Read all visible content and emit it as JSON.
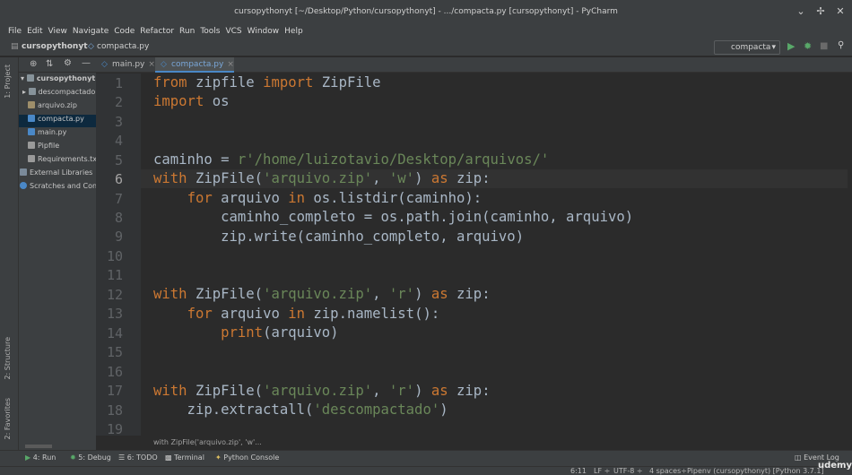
{
  "window": {
    "title": "cursopythonyt [~/Desktop/Python/cursopythonyt] - .../compacta.py [cursopythonyt] - PyCharm"
  },
  "menu": [
    "File",
    "Edit",
    "View",
    "Navigate",
    "Code",
    "Refactor",
    "Run",
    "Tools",
    "VCS",
    "Window",
    "Help"
  ],
  "nav": {
    "project": "cursopythonyt",
    "file": "compacta.py",
    "run_config": "compacta"
  },
  "left_tabs": {
    "project": "1: Project",
    "structure": "2: Structure",
    "favorites": "2: Favorites"
  },
  "project_tree": {
    "root": "cursopythonyt",
    "root_path": "~/",
    "items": [
      {
        "label": "descompactado",
        "icon": "folder-icon"
      },
      {
        "label": "arquivo.zip",
        "icon": "zip-file-icon"
      },
      {
        "label": "compacta.py",
        "icon": "python-file-icon"
      },
      {
        "label": "main.py",
        "icon": "python-file-icon"
      },
      {
        "label": "Pipfile",
        "icon": "file-icon"
      },
      {
        "label": "Requirements.txt",
        "icon": "text-file-icon"
      }
    ],
    "external": "External Libraries",
    "scratches": "Scratches and Cons"
  },
  "editor_tabs": [
    {
      "label": "main.py"
    },
    {
      "label": "compacta.py"
    }
  ],
  "line_numbers": [
    "1",
    "2",
    "3",
    "4",
    "5",
    "6",
    "7",
    "8",
    "9",
    "10",
    "11",
    "12",
    "13",
    "14",
    "15",
    "16",
    "17",
    "18",
    "19"
  ],
  "code": {
    "l1": [
      {
        "t": "from",
        "c": "kw"
      },
      {
        "t": " zipfile ",
        "c": "fn"
      },
      {
        "t": "import",
        "c": "kw"
      },
      {
        "t": " ZipFile",
        "c": "fn"
      }
    ],
    "l2": [
      {
        "t": "import",
        "c": "kw"
      },
      {
        "t": " os",
        "c": "fn"
      }
    ],
    "l5": [
      {
        "t": "caminho = ",
        "c": "fn"
      },
      {
        "t": "r'/home/luizotavio/Desktop/arquivos/'",
        "c": "str"
      }
    ],
    "l6": [
      {
        "t": "with",
        "c": "kw"
      },
      {
        "t": " ZipFile(",
        "c": "fn"
      },
      {
        "t": "'arquivo.zip'",
        "c": "str"
      },
      {
        "t": ", ",
        "c": "fn"
      },
      {
        "t": "'w'",
        "c": "str"
      },
      {
        "t": ") ",
        "c": "fn"
      },
      {
        "t": "as",
        "c": "kw"
      },
      {
        "t": " zip:",
        "c": "fn"
      }
    ],
    "l7": [
      {
        "t": "    ",
        "c": "fn"
      },
      {
        "t": "for",
        "c": "kw"
      },
      {
        "t": " arquivo ",
        "c": "fn"
      },
      {
        "t": "in",
        "c": "kw"
      },
      {
        "t": " os.listdir(caminho):",
        "c": "fn"
      }
    ],
    "l8": [
      {
        "t": "        caminho_completo = os.path.join(caminho, arquivo)",
        "c": "fn"
      }
    ],
    "l9": [
      {
        "t": "        zip.write(caminho_completo, arquivo)",
        "c": "fn"
      }
    ],
    "l12": [
      {
        "t": "with",
        "c": "kw"
      },
      {
        "t": " ZipFile(",
        "c": "fn"
      },
      {
        "t": "'arquivo.zip'",
        "c": "str"
      },
      {
        "t": ", ",
        "c": "fn"
      },
      {
        "t": "'r'",
        "c": "str"
      },
      {
        "t": ") ",
        "c": "fn"
      },
      {
        "t": "as",
        "c": "kw"
      },
      {
        "t": " zip:",
        "c": "fn"
      }
    ],
    "l13": [
      {
        "t": "    ",
        "c": "fn"
      },
      {
        "t": "for",
        "c": "kw"
      },
      {
        "t": " arquivo ",
        "c": "fn"
      },
      {
        "t": "in",
        "c": "kw"
      },
      {
        "t": " zip.namelist():",
        "c": "fn"
      }
    ],
    "l14": [
      {
        "t": "        ",
        "c": "fn"
      },
      {
        "t": "print",
        "c": "kw"
      },
      {
        "t": "(arquivo)",
        "c": "fn"
      }
    ],
    "l17": [
      {
        "t": "with",
        "c": "kw"
      },
      {
        "t": " ZipFile(",
        "c": "fn"
      },
      {
        "t": "'arquivo.zip'",
        "c": "str"
      },
      {
        "t": ", ",
        "c": "fn"
      },
      {
        "t": "'r'",
        "c": "str"
      },
      {
        "t": ") ",
        "c": "fn"
      },
      {
        "t": "as",
        "c": "kw"
      },
      {
        "t": " zip:",
        "c": "fn"
      }
    ],
    "l18": [
      {
        "t": "    zip.extractall(",
        "c": "fn"
      },
      {
        "t": "'descompactado'",
        "c": "str"
      },
      {
        "t": ")",
        "c": "fn"
      }
    ]
  },
  "breadcrumb_hint": "with ZipFile('arquivo.zip', 'w'...",
  "tool_windows": [
    "4: Run",
    "5: Debug",
    "6: TODO",
    "Terminal",
    "Python Console"
  ],
  "event_log": "Event Log",
  "status": {
    "position": "6:11",
    "line_sep": "LF ÷",
    "encoding": "UTF-8 ÷",
    "indent": "4 spaces÷",
    "interpreter": "Pipenv (cursopythonyt) [Python 3.7.1]"
  },
  "watermark": "udemy",
  "colors": {
    "keyword": "#cc7832",
    "string": "#6a8759",
    "text": "#a9b7c6",
    "background": "#2b2b2b"
  }
}
